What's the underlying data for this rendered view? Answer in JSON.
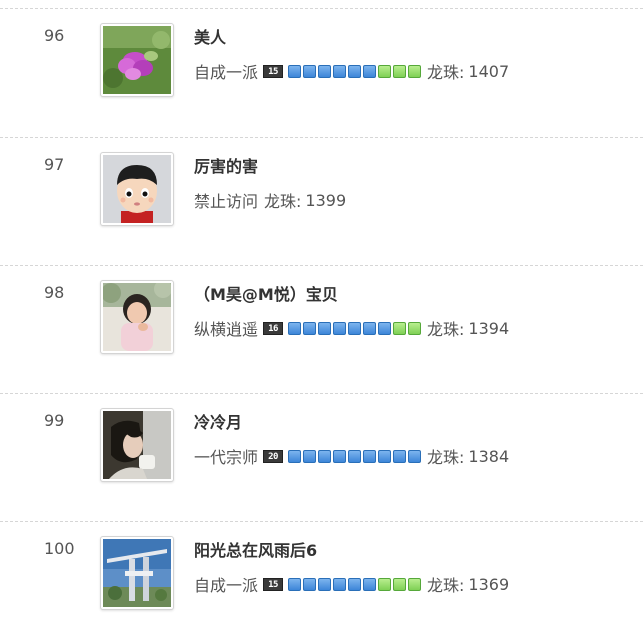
{
  "rows": [
    {
      "rank": "96",
      "name": "美人",
      "title": "自成一派",
      "level": "15",
      "blocks": [
        "blue",
        "blue",
        "blue",
        "blue",
        "blue",
        "blue",
        "green",
        "green",
        "green"
      ],
      "score_label": "龙珠:",
      "score": "1407",
      "avatar": "flower-photo"
    },
    {
      "rank": "97",
      "name": "厉害的害",
      "title": "禁止访问",
      "level": "",
      "blocks": [],
      "score_label": "龙珠:",
      "score": "1399",
      "avatar": "cartoon-boy"
    },
    {
      "rank": "98",
      "name": "（M昊@M悦）宝贝",
      "title": "纵横逍遥",
      "level": "16",
      "blocks": [
        "blue",
        "blue",
        "blue",
        "blue",
        "blue",
        "blue",
        "blue",
        "green",
        "green"
      ],
      "score_label": "龙珠:",
      "score": "1394",
      "avatar": "child-photo"
    },
    {
      "rank": "99",
      "name": "冷冷月",
      "title": "一代宗师",
      "level": "20",
      "blocks": [
        "blue",
        "blue",
        "blue",
        "blue",
        "blue",
        "blue",
        "blue",
        "blue",
        "blue"
      ],
      "score_label": "龙珠:",
      "score": "1384",
      "avatar": "woman-photo"
    },
    {
      "rank": "100",
      "name": "阳光总在风雨后6",
      "title": "自成一派",
      "level": "15",
      "blocks": [
        "blue",
        "blue",
        "blue",
        "blue",
        "blue",
        "blue",
        "green",
        "green",
        "green"
      ],
      "score_label": "龙珠:",
      "score": "1369",
      "avatar": "structure-photo"
    }
  ],
  "colors": {
    "block_blue": "#3d86d8",
    "block_green": "#7fd055",
    "badge_bg": "#3a3a3a",
    "divider": "#d6d6d6"
  }
}
